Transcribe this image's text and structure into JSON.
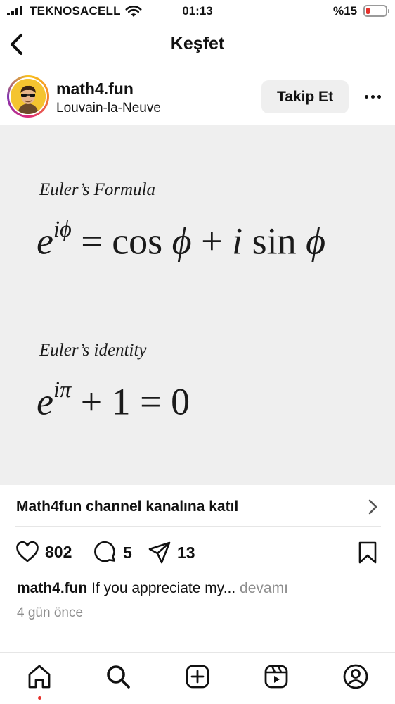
{
  "status_bar": {
    "carrier": "TEKNOSACELL",
    "time": "01:13",
    "battery": "%15"
  },
  "nav": {
    "title": "Keşfet"
  },
  "post": {
    "username": "math4.fun",
    "location": "Louvain-la-Neuve",
    "follow_label": "Takip Et",
    "image": {
      "formula_title": "Euler’s Formula",
      "identity_title": "Euler’s identity",
      "formula": {
        "base": "e",
        "exponent": "iϕ",
        "equals": " = cos ",
        "phi1": "ϕ",
        "plus": " + ",
        "i": "i",
        "sin": " sin ",
        "phi2": "ϕ"
      },
      "identity": {
        "base": "e",
        "exponent": "iπ",
        "rest": " + 1 = 0"
      }
    },
    "cta_label": "Math4fun channel kanalına katıl",
    "likes": "802",
    "comments": "5",
    "shares": "13",
    "caption_user": "math4.fun",
    "caption_text": " If you appreciate my...",
    "caption_more": " devamı",
    "time_ago": "4 gün önce"
  },
  "icons": {
    "back": "chevron-left-icon",
    "more": "more-horizontal-icon",
    "heart": "heart-icon",
    "comment": "comment-icon",
    "share": "share-icon",
    "bookmark": "bookmark-icon",
    "home": "home-icon",
    "search": "search-icon",
    "create": "plus-square-icon",
    "reels": "reels-icon",
    "profile": "profile-icon"
  },
  "colors": {
    "accent_red": "#e5312b",
    "muted_text": "#8e8e8e",
    "image_bg": "#efefef"
  }
}
